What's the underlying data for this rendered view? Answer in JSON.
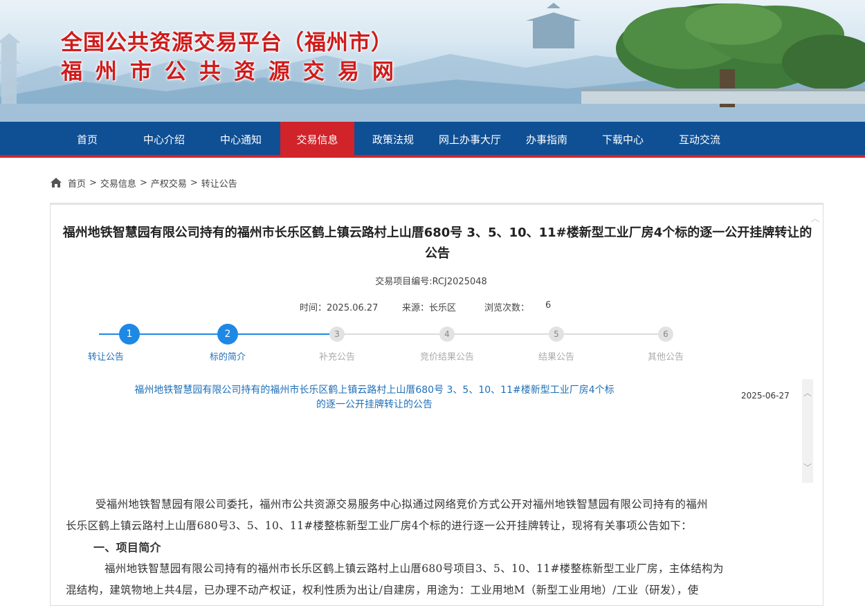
{
  "banner": {
    "title": "全国公共资源交易平台（福州市）",
    "subtitle": "福州市公共资源交易网"
  },
  "nav": {
    "items": [
      {
        "label": "首页",
        "active": false
      },
      {
        "label": "中心介绍",
        "active": false
      },
      {
        "label": "中心通知",
        "active": false
      },
      {
        "label": "交易信息",
        "active": true
      },
      {
        "label": "政策法规",
        "active": false
      },
      {
        "label": "网上办事大厅",
        "active": false
      },
      {
        "label": "办事指南",
        "active": false
      },
      {
        "label": "下载中心",
        "active": false
      },
      {
        "label": "互动交流",
        "active": false
      }
    ]
  },
  "breadcrumb": {
    "items": [
      "首页",
      "交易信息",
      "产权交易",
      "转让公告"
    ],
    "separator": ">"
  },
  "article": {
    "title": "福州地铁智慧园有限公司持有的福州市长乐区鹤上镇云路村上山厝680号 3、5、10、11#楼新型工业厂房4个标的逐一公开挂牌转让的公告",
    "project_no": "交易项目编号:RCJ2025048",
    "time": "时间：2025.06.27",
    "source": "来源：长乐区",
    "views_label": "浏览次数：",
    "views_value": "6"
  },
  "steps": [
    {
      "number": "1",
      "label": "转让公告",
      "state": "active"
    },
    {
      "number": "2",
      "label": "标的简介",
      "state": "active"
    },
    {
      "number": "3",
      "label": "补充公告",
      "state": "inactive"
    },
    {
      "number": "4",
      "label": "竞价结果公告",
      "state": "inactive"
    },
    {
      "number": "5",
      "label": "结果公告",
      "state": "inactive"
    },
    {
      "number": "6",
      "label": "其他公告",
      "state": "inactive"
    }
  ],
  "notice_list": [
    {
      "title_line1": "福州地铁智慧园有限公司持有的福州市长乐区鹤上镇云路村上山厝680号 3、5、10、11#楼新型工业厂房4个标",
      "title_line2": "的逐一公开挂牌转让的公告",
      "date": "2025-06-27"
    }
  ],
  "body": {
    "para1_line1": "受福州地铁智慧园有限公司委托，福州市公共资源交易服务中心拟通过网络竞价方式公开对福州地铁智慧园有限公司持有的福州",
    "para1_line2": "长乐区鹤上镇云路村上山厝680号3、5、10、11#楼整栋新型工业厂房4个标的进行逐一公开挂牌转让，现将有关事项公告如下：",
    "heading1": "一、项目简介",
    "para2_line1": "福州地铁智慧园有限公司持有的福州市长乐区鹤上镇云路村上山厝680号项目3、5、10、11#楼整栋新型工业厂房，主体结构为",
    "para2_line2": "混结构，建筑物地上共4层，已办理不动产权证，权利性质为出让/自建房，用途为：工业用地M（新型工业用地）/工业（研发），使"
  },
  "colors": {
    "nav_bg": "#0f4f94",
    "nav_active": "#d1232a",
    "title_red": "#cf1b1b",
    "link_blue": "#1e6fb8",
    "step_active": "#1e88e5"
  }
}
